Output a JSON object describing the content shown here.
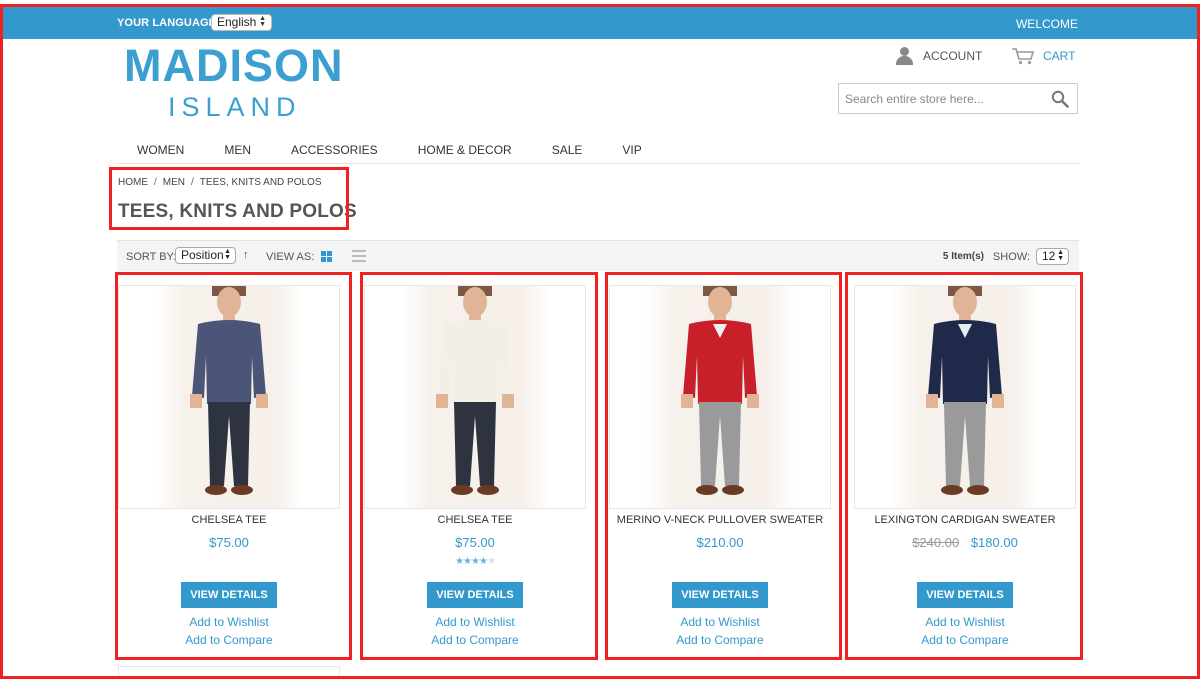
{
  "topbar": {
    "language_label": "YOUR LANGUAGE:",
    "language_value": "English",
    "welcome": "WELCOME"
  },
  "header": {
    "logo_main": "MADISON",
    "logo_sub": "ISLAND",
    "account": "ACCOUNT",
    "cart": "CART",
    "search_placeholder": "Search entire store here..."
  },
  "nav": {
    "items": [
      {
        "label": "WOMEN"
      },
      {
        "label": "MEN"
      },
      {
        "label": "ACCESSORIES"
      },
      {
        "label": "HOME & DECOR"
      },
      {
        "label": "SALE"
      },
      {
        "label": "VIP"
      }
    ]
  },
  "breadcrumb": {
    "items": [
      {
        "label": "HOME"
      },
      {
        "label": "MEN"
      },
      {
        "label": "TEES, KNITS AND POLOS"
      }
    ],
    "separator": "/"
  },
  "page_title": "TEES, KNITS AND POLOS",
  "toolbar": {
    "sort_by_label": "SORT BY:",
    "sort_value": "Position",
    "sort_direction": "↑",
    "view_as_label": "VIEW AS:",
    "item_count": "5 Item(s)",
    "show_label": "SHOW:",
    "show_value": "12"
  },
  "products": [
    {
      "name": "CHELSEA TEE",
      "price": "$75.00",
      "old_price": "",
      "rating_stars": 0,
      "shirt_color": "#4a5578",
      "collar": "#4a5578",
      "pants_color": "#2d3440",
      "details_label": "VIEW DETAILS",
      "wishlist_label": "Add to Wishlist",
      "compare_label": "Add to Compare"
    },
    {
      "name": "CHELSEA TEE",
      "price": "$75.00",
      "old_price": "",
      "rating_stars": 4,
      "shirt_color": "#f2efe9",
      "collar": "#f2efe9",
      "pants_color": "#2d3440",
      "details_label": "VIEW DETAILS",
      "wishlist_label": "Add to Wishlist",
      "compare_label": "Add to Compare"
    },
    {
      "name": "MERINO V-NECK PULLOVER SWEATER",
      "price": "$210.00",
      "old_price": "",
      "rating_stars": 0,
      "shirt_color": "#c8202b",
      "collar": "#eef0f4",
      "pants_color": "#9a9a9a",
      "details_label": "VIEW DETAILS",
      "wishlist_label": "Add to Wishlist",
      "compare_label": "Add to Compare"
    },
    {
      "name": "LEXINGTON CARDIGAN SWEATER",
      "price": "$180.00",
      "old_price": "$240.00",
      "rating_stars": 0,
      "shirt_color": "#1f2a4a",
      "collar": "#e8ecf3",
      "pants_color": "#9a9a9a",
      "details_label": "VIEW DETAILS",
      "wishlist_label": "Add to Wishlist",
      "compare_label": "Add to Compare"
    }
  ],
  "colors": {
    "accent": "#3399cc",
    "annotation": "#ee2222"
  }
}
